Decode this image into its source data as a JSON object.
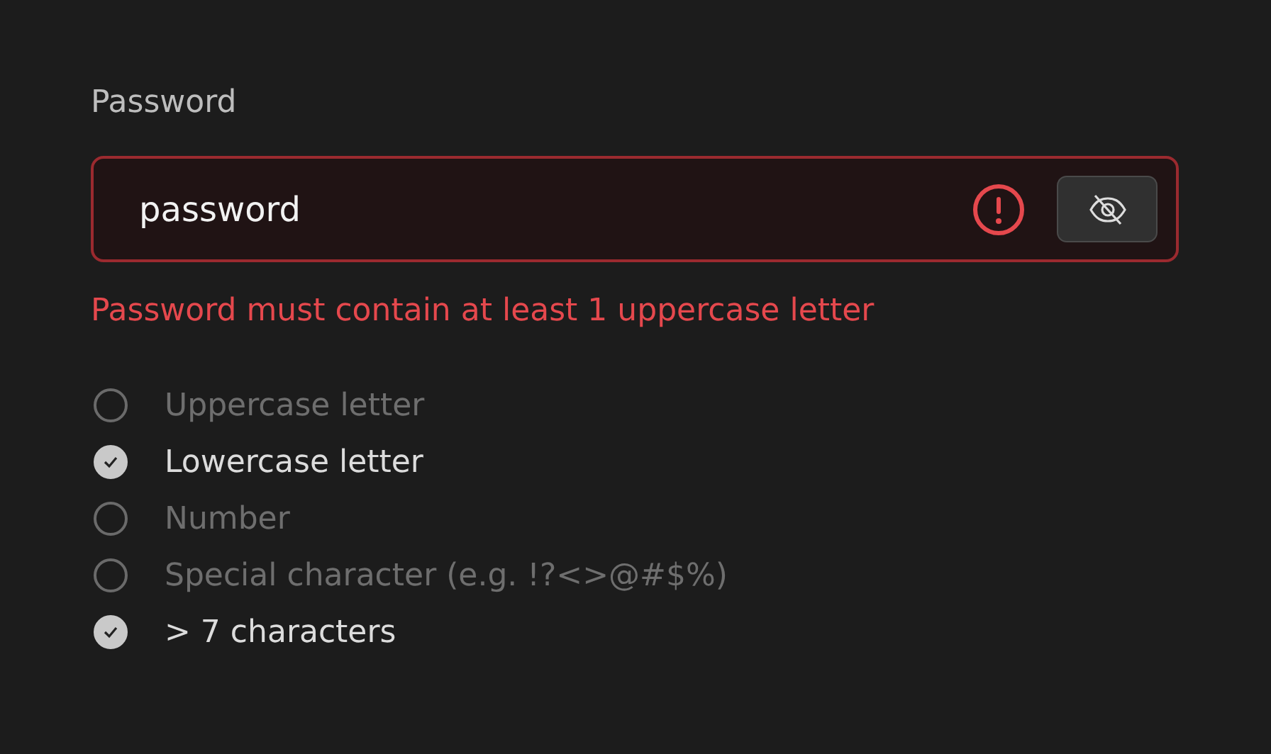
{
  "field": {
    "label": "Password",
    "value": "password",
    "invalid": true,
    "password_visible": true
  },
  "error": "Password must contain at least 1 uppercase letter",
  "requirements": [
    {
      "label": "Uppercase letter",
      "checked": false
    },
    {
      "label": "Lowercase letter",
      "checked": true
    },
    {
      "label": "Number",
      "checked": false
    },
    {
      "label": "Special character (e.g. !?<>@#$%)",
      "checked": false
    },
    {
      "label": "> 7 characters",
      "checked": true
    }
  ]
}
